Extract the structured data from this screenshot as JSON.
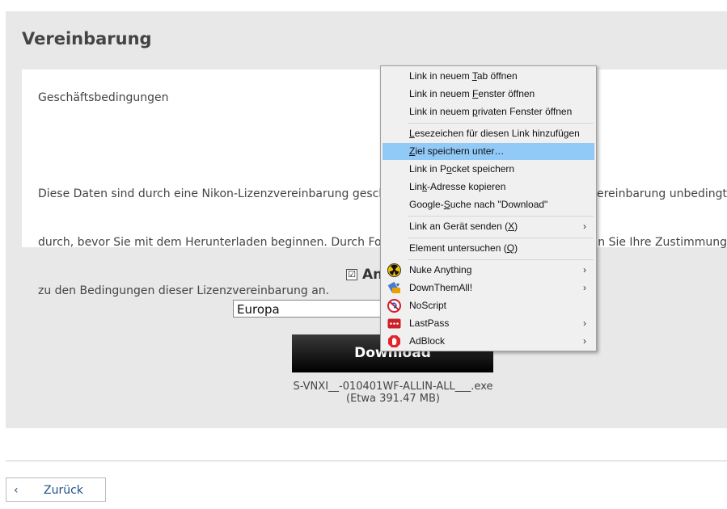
{
  "page": {
    "title": "Vereinbarung",
    "terms_heading": "Geschäftsbedingungen",
    "terms_lines": [
      "Diese Daten sind durch eine Nikon-Lizenzvereinbarung gesch",
      "durch, bevor Sie mit dem Herunterladen beginnen. Durch Fo",
      "zu den Bedingungen dieser Lizenzvereinbarung an."
    ],
    "terms_lines_right": [
      "ereinbarung unbedingt",
      "n Sie Ihre Zustimmung"
    ],
    "agree_label": "An",
    "agree_checked": true,
    "checkmark": "☑",
    "region_value": "Europa",
    "download_label": "Download",
    "file_name": "S-VNXI__-010401WF-ALLIN-ALL___.exe",
    "file_size": "(Etwa 391.47 MB)",
    "back_label": "Zurück",
    "back_chevron": "‹"
  },
  "context_menu": {
    "items": [
      {
        "pre": "Link in neuem ",
        "acc": "T",
        "post": "ab öffnen"
      },
      {
        "pre": "Link in neuem ",
        "acc": "F",
        "post": "enster öffnen"
      },
      {
        "pre": "Link in neuem ",
        "acc": "p",
        "post": "rivaten Fenster öffnen"
      },
      {
        "pre": "",
        "acc": "L",
        "post": "esezeichen für diesen Link hinzufügen"
      },
      {
        "pre": "",
        "acc": "Z",
        "post": "iel speichern unter…",
        "highlighted": true
      },
      {
        "pre": "Link in P",
        "acc": "o",
        "post": "cket speichern"
      },
      {
        "pre": "Lin",
        "acc": "k",
        "post": "-Adresse kopieren"
      },
      {
        "pre": "Google-",
        "acc": "S",
        "post": "uche nach \"Download\""
      },
      {
        "pre": "Link an Gerät senden (",
        "acc": "X",
        "post": ")",
        "submenu": true
      },
      {
        "pre": "Element untersuchen (",
        "acc": "Q",
        "post": ")"
      },
      {
        "pre": "Nuke Anything",
        "acc": "",
        "post": "",
        "submenu": true,
        "icon": "nuke-icon"
      },
      {
        "pre": "DownThemAll!",
        "acc": "",
        "post": "",
        "submenu": true,
        "icon": "downthemall-icon"
      },
      {
        "pre": "NoScript",
        "acc": "",
        "post": "",
        "icon": "noscript-icon"
      },
      {
        "pre": "LastPass",
        "acc": "",
        "post": "",
        "submenu": true,
        "icon": "lastpass-icon"
      },
      {
        "pre": "AdBlock",
        "acc": "",
        "post": "",
        "submenu": true,
        "icon": "adblock-icon"
      }
    ],
    "submenu_arrow": "›"
  },
  "colors": {
    "highlight": "#91c9f7",
    "link": "#1c4f8c",
    "panel": "#e8e8e8"
  }
}
